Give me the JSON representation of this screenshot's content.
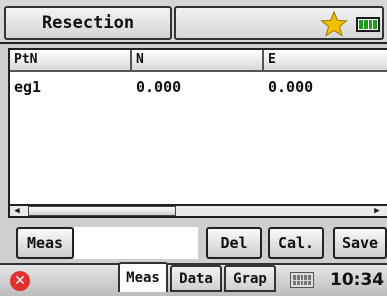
{
  "header": {
    "title": "Resection",
    "icons": [
      "star-icon",
      "battery-icon"
    ],
    "star_color": "#f0c000",
    "battery_color": "#1d9c1d"
  },
  "table": {
    "columns": [
      "PtN",
      "N",
      "E"
    ],
    "rows": [
      [
        "eg1",
        "0.000",
        "0.000"
      ]
    ]
  },
  "buttons": {
    "meas": "Meas",
    "del": "Del",
    "cal": "Cal.",
    "save": "Save"
  },
  "tabs": [
    {
      "label": "Meas",
      "active": true
    },
    {
      "label": "Data",
      "active": false
    },
    {
      "label": "Grap",
      "active": false
    }
  ],
  "status": {
    "time": "10:34",
    "close_color": "#e03030"
  }
}
